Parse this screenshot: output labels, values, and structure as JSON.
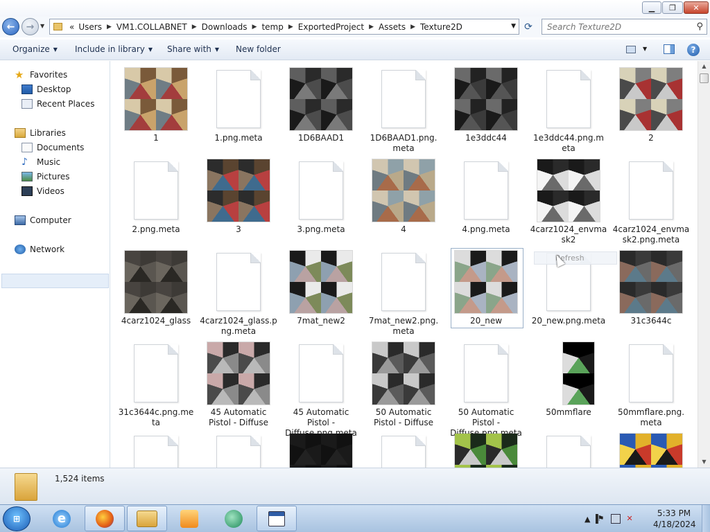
{
  "window": {
    "buttons": {
      "minimize": "▁",
      "maximize": "❐",
      "close": "✕"
    }
  },
  "address": {
    "breadcrumbs": [
      "«",
      "Users",
      "VM1.COLLABNET",
      "Downloads",
      "temp",
      "ExportedProject",
      "Assets",
      "Texture2D"
    ],
    "search_placeholder": "Search Texture2D"
  },
  "commandbar": {
    "organize": "Organize",
    "include_in_library": "Include in library",
    "share_with": "Share with",
    "new_folder": "New folder"
  },
  "navpane": {
    "favorites": "Favorites",
    "desktop": "Desktop",
    "recent_places": "Recent Places",
    "libraries": "Libraries",
    "documents": "Documents",
    "music": "Music",
    "pictures": "Pictures",
    "videos": "Videos",
    "computer": "Computer",
    "network": "Network"
  },
  "files": [
    {
      "name": "1",
      "kind": "texture",
      "colors": [
        "#7a5a3a",
        "#c9a36b",
        "#a33d3d",
        "#6f7d85",
        "#d8c9a8"
      ]
    },
    {
      "name": "1.png.meta",
      "kind": "blank"
    },
    {
      "name": "1D6BAAD1",
      "kind": "texture",
      "colors": [
        "#2a2a2a",
        "#4c4c4c",
        "#7a7a7a",
        "#1a1a1a",
        "#5e5e5e"
      ]
    },
    {
      "name": "1D6BAAD1.png.\nmeta",
      "kind": "blank"
    },
    {
      "name": "1e3ddc44",
      "kind": "texture",
      "colors": [
        "#222",
        "#3b3b3b",
        "#555",
        "#1a1a1a",
        "#6a6a6a"
      ]
    },
    {
      "name": "1e3ddc44.png.m\neta",
      "kind": "blank"
    },
    {
      "name": "2",
      "kind": "texture",
      "colors": [
        "#7e7e7e",
        "#a83232",
        "#c9c9c9",
        "#4a4a4a",
        "#d8d2b8"
      ]
    },
    {
      "name": "2.png.meta",
      "kind": "blank"
    },
    {
      "name": "3",
      "kind": "texture",
      "colors": [
        "#5a4430",
        "#b84040",
        "#3f6b8e",
        "#8a7560",
        "#2c2c2c"
      ]
    },
    {
      "name": "3.png.meta",
      "kind": "blank"
    },
    {
      "name": "4",
      "kind": "texture",
      "colors": [
        "#8fa1a8",
        "#b9a98a",
        "#a86b4a",
        "#6f7b82",
        "#d1c6b0"
      ]
    },
    {
      "name": "4.png.meta",
      "kind": "blank"
    },
    {
      "name": "4carz1024_envma\nsk2",
      "kind": "texture",
      "colors": [
        "#2a2a2a",
        "#dcdcdc",
        "#6a6a6a",
        "#f4f4f4",
        "#1a1a1a"
      ]
    },
    {
      "name": "4carz1024_envma\nsk2.png.meta",
      "kind": "blank"
    },
    {
      "name": "4carz1024_glass",
      "kind": "texture",
      "colors": [
        "#3d3a36",
        "#5a5650",
        "#2a2824",
        "#6b665e",
        "#484440"
      ]
    },
    {
      "name": "4carz1024_glass.p\nng.meta",
      "kind": "blank"
    },
    {
      "name": "7mat_new2",
      "kind": "texture",
      "colors": [
        "#eaeaea",
        "#7d8a5a",
        "#b9a2a2",
        "#8ea0b0",
        "#1a1a1a"
      ]
    },
    {
      "name": "7mat_new2.png.\nmeta",
      "kind": "blank"
    },
    {
      "name": "20_new",
      "kind": "texture",
      "colors": [
        "#1a1a1a",
        "#a9b3c2",
        "#c49a8a",
        "#8aa58a",
        "#dcdcdc"
      ]
    },
    {
      "name": "20_new.png.meta",
      "kind": "blank"
    },
    {
      "name": "31c3644c",
      "kind": "texture",
      "colors": [
        "#3a3a3a",
        "#6a6a6a",
        "#5c7a8a",
        "#8a6a5c",
        "#2a2a2a"
      ]
    },
    {
      "name": "31c3644c.png.me\nta",
      "kind": "blank"
    },
    {
      "name": "45 Automatic\nPistol - Diffuse",
      "kind": "texture",
      "colors": [
        "#2a2a2a",
        "#8a8a8a",
        "#b9b9b9",
        "#4a4a4a",
        "#c9a9a9"
      ]
    },
    {
      "name": "45 Automatic\nPistol -\nDiffuse.png.meta",
      "kind": "blank"
    },
    {
      "name": "50 Automatic\nPistol - Diffuse",
      "kind": "texture",
      "colors": [
        "#2a2a2a",
        "#5a5a5a",
        "#9a9a9a",
        "#3a3a3a",
        "#c9c9c9"
      ]
    },
    {
      "name": "50 Automatic\nPistol -\nDiffuse.png.meta",
      "kind": "blank"
    },
    {
      "name": "50mmflare",
      "kind": "texture",
      "colors": [
        "#000",
        "#1a1a1a",
        "#5aa35a",
        "#dcdcdc",
        "#000"
      ]
    },
    {
      "name": "50mmflare.png.\nmeta",
      "kind": "blank"
    },
    {
      "name": "",
      "kind": "blank"
    },
    {
      "name": "",
      "kind": "blank"
    },
    {
      "name": "",
      "kind": "texture",
      "colors": [
        "#111",
        "#1a1a1a",
        "#222",
        "#111",
        "#1a1a1a"
      ]
    },
    {
      "name": "",
      "kind": "blank"
    },
    {
      "name": "",
      "kind": "texture",
      "colors": [
        "#1a2a1a",
        "#4a8a3a",
        "#c9c9c9",
        "#2a2a2a",
        "#a3c34a"
      ]
    },
    {
      "name": "",
      "kind": "blank"
    },
    {
      "name": "",
      "kind": "texture",
      "colors": [
        "#e2b12a",
        "#c93a2a",
        "#1a1a1a",
        "#f2d24a",
        "#2a5ab3"
      ]
    }
  ],
  "tooltip": {
    "text": "Refresh"
  },
  "details": {
    "count": "1,524 items"
  },
  "taskbar": {
    "time": "5:33 PM",
    "date": "4/18/2024"
  },
  "colors": {
    "selection": "#e5eef9",
    "accent": "#2c67c2"
  }
}
